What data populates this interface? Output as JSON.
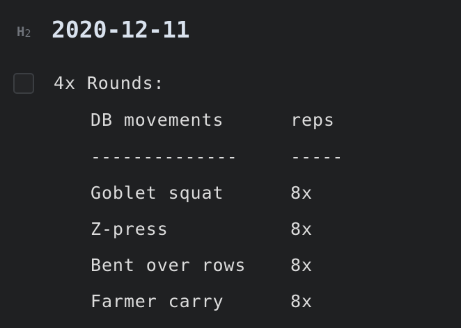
{
  "heading": {
    "marker": "H",
    "marker_level": "2",
    "text": "2020-12-11"
  },
  "task": {
    "checked": false,
    "title": "4x Rounds:"
  },
  "table": {
    "headers": [
      "DB movements",
      "reps"
    ],
    "separators": [
      "--------------",
      "-----"
    ],
    "rows": [
      [
        "Goblet squat",
        "8x"
      ],
      [
        "Z-press",
        "8x"
      ],
      [
        "Bent over rows",
        "8x"
      ],
      [
        "Farmer carry",
        "8x"
      ]
    ]
  }
}
